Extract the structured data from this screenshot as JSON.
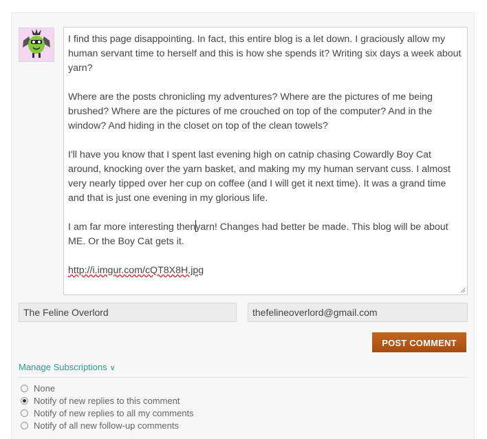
{
  "comment": {
    "paragraphs": [
      "I find this page disappointing. In fact, this entire blog is a let down. I graciously allow my human servant time to herself and this is how she spends it? Writing six days a week about yarn?",
      "Where are the posts chronicling my adventures? Where are the pictures of me being brushed? Where are the pictures of me crouched on top of the computer? And in the window? And hiding in the closet on top of the clean towels?",
      "I'll have you know that I spent last evening high on catnip chasing Cowardly Boy Cat around, knocking over the yarn basket, and making my my human servant cuss. I almost very nearly tipped over her cup on coffee (and I will get it next time). It was a grand time and that is just one evening in my glorious life."
    ],
    "last_before_caret": "I am far more interesting then",
    "last_after_caret": "yarn! Changes had better be made. This blog will be about ME. Or the Boy Cat gets it.",
    "link": "http://i.imgur.com/cQT8X8H.jpg"
  },
  "form": {
    "name_value": "The Feline Overlord",
    "email_value": "thefelineoverlord@gmail.com",
    "post_label": "POST COMMENT"
  },
  "subscriptions": {
    "manage_label": "Manage Subscriptions",
    "chevron": "∨",
    "options": [
      {
        "label": "None",
        "checked": false
      },
      {
        "label": "Notify of new replies to this comment",
        "checked": true
      },
      {
        "label": "Notify of new replies to all my comments",
        "checked": false
      },
      {
        "label": "Notify of all new follow-up comments",
        "checked": false
      }
    ]
  },
  "colors": {
    "button": "#b8591a",
    "link_accent": "#2c9e8a",
    "avatar_bg": "#f6d7f1"
  },
  "icons": {
    "avatar": "green-bat-monster-avatar-icon",
    "resize": "resize-handle-icon"
  }
}
